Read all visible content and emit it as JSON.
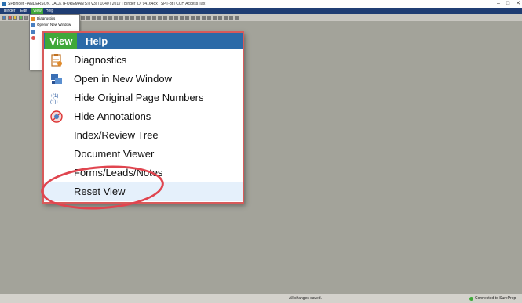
{
  "window": {
    "title": "SPbinder - ANDERSON, JACK (FOREMAN'S) (V3) | 1040 | 2017 | Binder ID: 94164gx | SPT-3t | CCH Access Tax",
    "minimize": "–",
    "maximize": "□",
    "close": "✕"
  },
  "menubar": {
    "items": [
      {
        "label": "Binder"
      },
      {
        "label": "Edit"
      },
      {
        "label": "View"
      },
      {
        "label": "Help"
      }
    ]
  },
  "small_menu": {
    "items": [
      {
        "label": "Diagnostics"
      },
      {
        "label": "Open in New Window"
      }
    ]
  },
  "zoom_menu": {
    "tabs": [
      {
        "label": "View"
      },
      {
        "label": "Help"
      }
    ],
    "items": [
      {
        "label": "Diagnostics",
        "icon": "diagnostics-icon"
      },
      {
        "label": "Open in New Window",
        "icon": "new-window-icon"
      },
      {
        "label": "Hide Original Page Numbers",
        "icon": "page-numbers-icon"
      },
      {
        "label": "Hide Annotations",
        "icon": "annotations-icon"
      },
      {
        "label": "Index/Review Tree",
        "icon": ""
      },
      {
        "label": "Document Viewer",
        "icon": ""
      },
      {
        "label": "Forms/Leads/Notes",
        "icon": ""
      },
      {
        "label": "Reset View",
        "icon": ""
      }
    ],
    "highlighted": "Reset View"
  },
  "status": {
    "center": "All changes saved.",
    "right": "Connected to SurePrep"
  },
  "colors": {
    "menubar_bg": "#1f3d73",
    "active_tab": "#3fa83a",
    "zoom_bar": "#2b6aa8",
    "workspace": "#a3a39a",
    "highlight_circle": "#e0454f"
  }
}
